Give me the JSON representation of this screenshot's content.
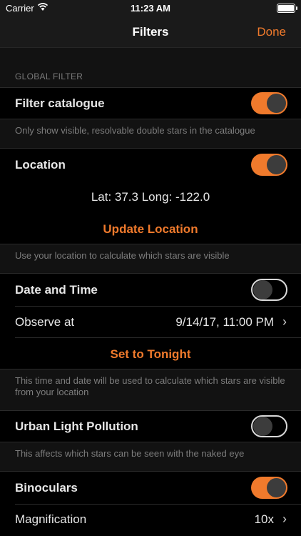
{
  "status": {
    "carrier": "Carrier",
    "time": "11:23 AM"
  },
  "nav": {
    "title": "Filters",
    "done": "Done"
  },
  "global_filter": {
    "header": "GLOBAL FILTER",
    "filter_catalogue": {
      "label": "Filter catalogue",
      "on": true
    },
    "filter_footer": "Only show visible, resolvable double stars in the catalogue"
  },
  "location": {
    "label": "Location",
    "on": true,
    "coords": "Lat: 37.3 Long: -122.0",
    "update_label": "Update Location",
    "footer": "Use your location to calculate which stars are visible"
  },
  "datetime": {
    "label": "Date and Time",
    "on": false,
    "observe_label": "Observe at",
    "observe_value": "9/14/17, 11:00 PM",
    "set_tonight": "Set to Tonight",
    "footer": "This time and date will be used to calculate which stars are visible from your location"
  },
  "light_pollution": {
    "label": "Urban Light Pollution",
    "on": false,
    "footer": "This affects which stars can be seen with the naked eye"
  },
  "binoculars": {
    "label": "Binoculars",
    "on": true,
    "magnification_label": "Magnification",
    "magnification_value": "10x"
  },
  "colors": {
    "accent": "#f07a2c",
    "background": "#121212",
    "cell": "#000000"
  }
}
